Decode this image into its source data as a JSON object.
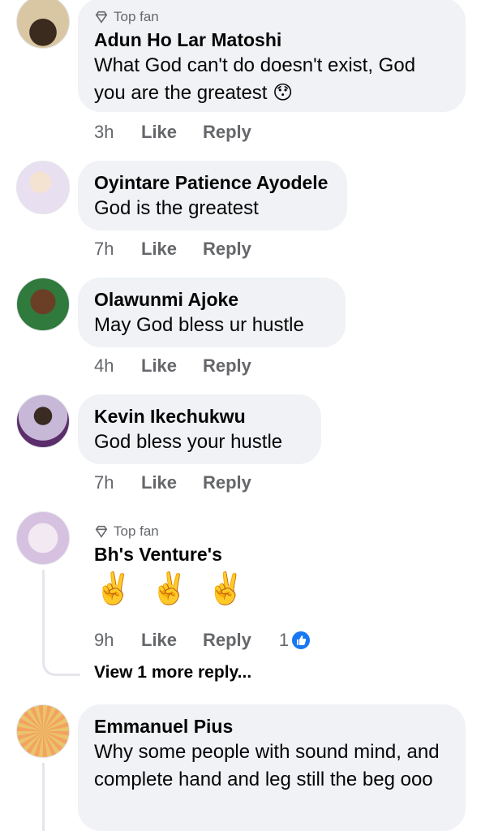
{
  "comments": [
    {
      "badge": "Top fan",
      "name": "Adun Ho Lar Matoshi",
      "text": "What God can't do doesn't exist, God you are the greatest 😯",
      "time": "3h",
      "like": "Like",
      "reply": "Reply"
    },
    {
      "name": "Oyintare Patience Ayodele",
      "text": "God is the greatest",
      "time": "7h",
      "like": "Like",
      "reply": "Reply"
    },
    {
      "name": "Olawunmi Ajoke",
      "text": "May God bless ur hustle",
      "time": "4h",
      "like": "Like",
      "reply": "Reply"
    },
    {
      "name": "Kevin Ikechukwu",
      "text": "God bless your hustle",
      "time": "7h",
      "like": "Like",
      "reply": "Reply"
    },
    {
      "badge": "Top fan",
      "name": "Bh's Venture's",
      "emojis": [
        "✌️",
        "✌️",
        "✌️"
      ],
      "time": "9h",
      "like": "Like",
      "reply": "Reply",
      "reaction_count": "1"
    },
    {
      "name": "Emmanuel Pius",
      "text": "Why some people with sound mind, and complete hand and leg still the beg ooo"
    }
  ],
  "view_more": "View 1 more reply...",
  "colors": {
    "bubble": "#f0f2f5",
    "meta": "#65676b",
    "like_blue": "#1877f2"
  }
}
